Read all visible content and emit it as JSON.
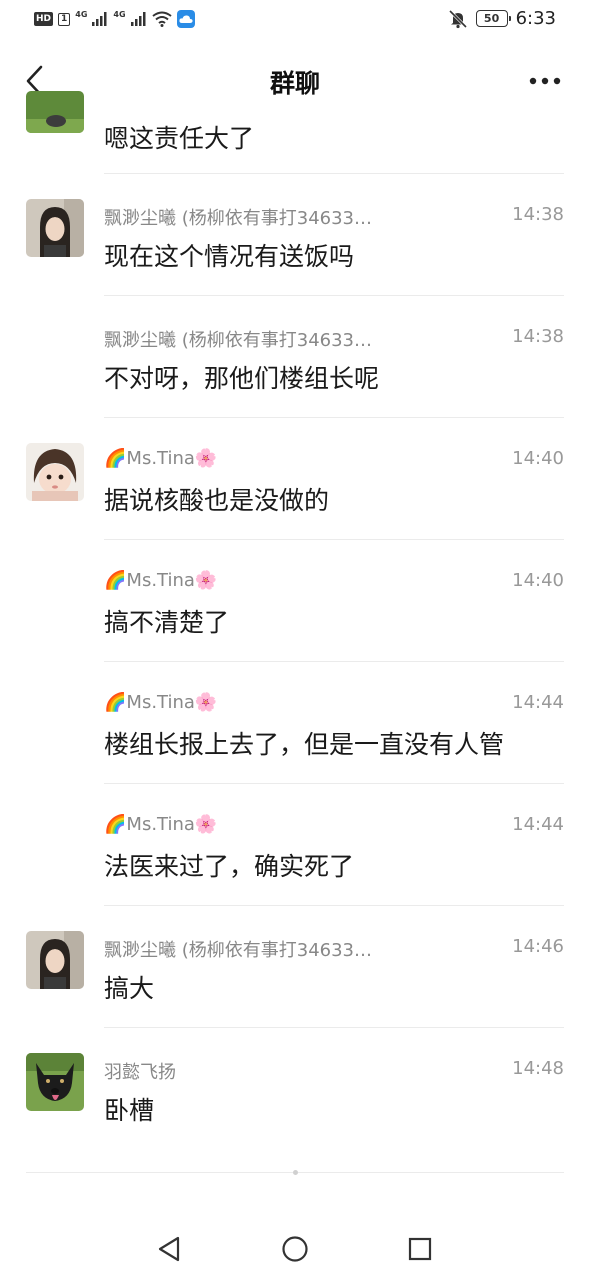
{
  "status_bar": {
    "hd_label": "HD",
    "sim_label": "1",
    "network_1": "4G",
    "network_2": "4G",
    "battery": "50",
    "time": "6:33",
    "icons": [
      "signal-icon",
      "wifi-icon",
      "weather-icon",
      "mute-bell-icon",
      "battery-icon"
    ]
  },
  "header": {
    "title": "群聊",
    "back_icon": "chevron-left-icon",
    "more_icon": "more-dots-icon"
  },
  "messages": [
    {
      "sender": "",
      "time": "",
      "text": "嗯这责任大了",
      "avatar": "green-avatar"
    },
    {
      "sender": "飘渺尘曦 (杨柳依有事打34633…",
      "time": "14:38",
      "text": "现在这个情况有送饭吗",
      "avatar": "girl-avatar"
    },
    {
      "sender": "飘渺尘曦 (杨柳依有事打34633…",
      "time": "14:38",
      "text": "不对呀，那他们楼组长呢",
      "avatar": ""
    },
    {
      "sender": "🌈Ms.Tina🌸",
      "time": "14:40",
      "text": "据说核酸也是没做的",
      "avatar": "child-avatar"
    },
    {
      "sender": "🌈Ms.Tina🌸",
      "time": "14:40",
      "text": "搞不清楚了",
      "avatar": ""
    },
    {
      "sender": "🌈Ms.Tina🌸",
      "time": "14:44",
      "text": "楼组长报上去了，但是一直没有人管",
      "avatar": ""
    },
    {
      "sender": "🌈Ms.Tina🌸",
      "time": "14:44",
      "text": "法医来过了，确实死了",
      "avatar": ""
    },
    {
      "sender": "飘渺尘曦 (杨柳依有事打34633…",
      "time": "14:46",
      "text": "搞大",
      "avatar": "girl-avatar"
    },
    {
      "sender": "羽懿飞扬",
      "time": "14:48",
      "text": "卧槽",
      "avatar": "dog-avatar"
    }
  ],
  "nav_bar": {
    "icons": [
      "back-triangle-icon",
      "home-circle-icon",
      "recents-square-icon"
    ]
  },
  "colors": {
    "background": "#ffffff",
    "text_primary": "#1a1a1a",
    "text_secondary": "#888888",
    "divider": "#ebebeb"
  }
}
